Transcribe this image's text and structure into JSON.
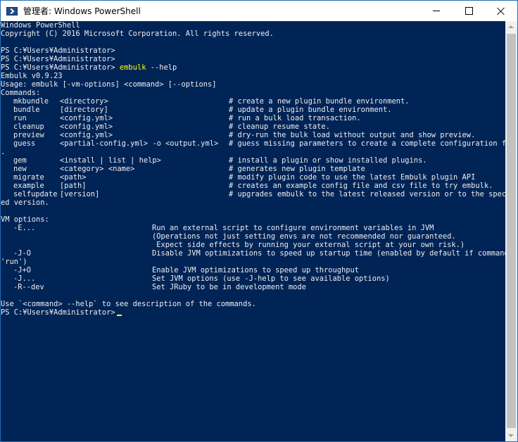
{
  "window": {
    "title": "管理者: Windows PowerShell",
    "icon": "powershell-icon"
  },
  "console": {
    "banner": "Windows PowerShell",
    "copyright": "Copyright (C) 2016 Microsoft Corporation. All rights reserved.",
    "prompt": "PS C:¥Users¥Administrator>",
    "command_name": "embulk",
    "command_args": " --help",
    "version": "Embulk v0.9.23",
    "usage": "Usage: embulk [-vm-options] <command> [--options]",
    "commands_header": "Commands:",
    "commands": [
      {
        "name": "mkbundle",
        "args": "<directory>",
        "desc": "# create a new plugin bundle environment."
      },
      {
        "name": "bundle",
        "args": "[directory]",
        "desc": "# update a plugin bundle environment."
      },
      {
        "name": "run",
        "args": "<config.yml>",
        "desc": "# run a bulk load transaction."
      },
      {
        "name": "cleanup",
        "args": "<config.yml>",
        "desc": "# cleanup resume state."
      },
      {
        "name": "preview",
        "args": "<config.yml>",
        "desc": "# dry-run the bulk load without output and show preview."
      },
      {
        "name": "guess",
        "args": "<partial-config.yml> -o <output.yml>",
        "desc": "# guess missing parameters to create a complete configuration file"
      },
      {
        "wrap": "."
      },
      {
        "name": "gem",
        "args": "<install | list | help>",
        "desc": "# install a plugin or show installed plugins."
      },
      {
        "name": "new",
        "args": "<category> <name>",
        "desc": "# generates new plugin template"
      },
      {
        "name": "migrate",
        "args": "<path>",
        "desc": "# modify plugin code to use the latest Embulk plugin API"
      },
      {
        "name": "example",
        "args": "[path]",
        "desc": "# creates an example config file and csv file to try embulk."
      },
      {
        "name": "selfupdate",
        "args": "[version]",
        "desc": "# upgrades embulk to the latest released version or to the specifi"
      },
      {
        "wrap": "ed version."
      }
    ],
    "vm_header": "VM options:",
    "vm_options": [
      {
        "name": "-E...",
        "desc": "Run an external script to configure environment variables in JVM"
      },
      {
        "cont": "(Operations not just setting envs are not recommended nor guaranteed."
      },
      {
        "cont": " Expect side effects by running your external script at your own risk.)"
      },
      {
        "name": "-J-O",
        "desc": "Disable JVM optimizations to speed up startup time (enabled by default if command is"
      },
      {
        "wrap": "'run')"
      },
      {
        "name": "-J+O",
        "desc": "Enable JVM optimizations to speed up throughput"
      },
      {
        "name": "-J...",
        "desc": "Set JVM options (use -J-help to see available options)"
      },
      {
        "name": "-R--dev",
        "desc": "Set JRuby to be in development mode"
      }
    ],
    "footer": "Use `<command> --help` to see description of the commands.",
    "final_prompt": "PS C:¥Users¥Administrator>"
  },
  "colors": {
    "console_background": "#012456",
    "console_text": "#eeedf0",
    "command_highlight": "#ffff00"
  }
}
